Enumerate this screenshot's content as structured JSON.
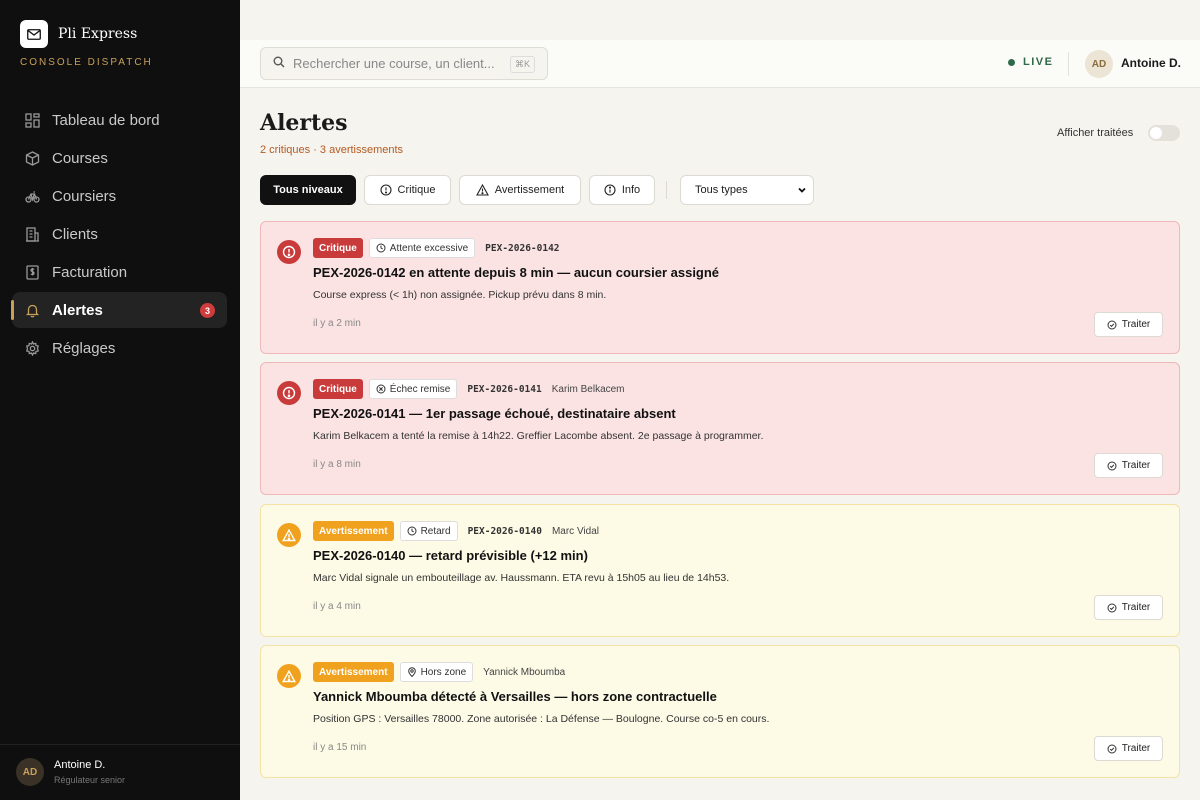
{
  "brand": {
    "name": "Pli Express",
    "subtitle": "CONSOLE DISPATCH"
  },
  "sidebar": {
    "items": [
      {
        "label": "Tableau de bord",
        "icon": "dashboard-icon"
      },
      {
        "label": "Courses",
        "icon": "package-icon"
      },
      {
        "label": "Coursiers",
        "icon": "bike-icon"
      },
      {
        "label": "Clients",
        "icon": "building-icon"
      },
      {
        "label": "Facturation",
        "icon": "invoice-icon"
      },
      {
        "label": "Alertes",
        "icon": "bell-icon",
        "active": true,
        "badge": "3"
      },
      {
        "label": "Réglages",
        "icon": "gear-icon"
      }
    ],
    "user": {
      "initials": "AD",
      "name": "Antoine D.",
      "role": "Régulateur senior"
    }
  },
  "topbar": {
    "search_placeholder": "Rechercher une course, un client...",
    "shortcut": "⌘K",
    "live_label": "LIVE",
    "user": {
      "initials": "AD",
      "name": "Antoine D."
    }
  },
  "page": {
    "title": "Alertes",
    "summary": "2 critiques · 3 avertissements",
    "toggle_label": "Afficher traitées",
    "toggle_on": false
  },
  "filters": {
    "levels": [
      {
        "label": "Tous niveaux",
        "active": true
      },
      {
        "label": "Critique",
        "icon": "alert-circle-icon"
      },
      {
        "label": "Avertissement",
        "icon": "warning-triangle-icon"
      },
      {
        "label": "Info",
        "icon": "info-icon"
      }
    ],
    "type_select": "Tous types"
  },
  "alerts": [
    {
      "level": "critical",
      "level_label": "Critique",
      "type": "Attente excessive",
      "type_icon": "clock-icon",
      "ref": "PEX-2026-0142",
      "courier": "",
      "title": "PEX-2026-0142 en attente depuis 8 min — aucun coursier assigné",
      "description": "Course express (< 1h) non assignée. Pickup prévu dans 8 min.",
      "time": "il y a 2 min",
      "action": "Traiter"
    },
    {
      "level": "critical",
      "level_label": "Critique",
      "type": "Échec remise",
      "type_icon": "x-circle-icon",
      "ref": "PEX-2026-0141",
      "courier": "Karim Belkacem",
      "title": "PEX-2026-0141 — 1er passage échoué, destinataire absent",
      "description": "Karim Belkacem a tenté la remise à 14h22. Greffier Lacombe absent. 2e passage à programmer.",
      "time": "il y a 8 min",
      "action": "Traiter"
    },
    {
      "level": "warning",
      "level_label": "Avertissement",
      "type": "Retard",
      "type_icon": "clock-icon",
      "ref": "PEX-2026-0140",
      "courier": "Marc Vidal",
      "title": "PEX-2026-0140 — retard prévisible (+12 min)",
      "description": "Marc Vidal signale un embouteillage av. Haussmann. ETA revu à 15h05 au lieu de 14h53.",
      "time": "il y a 4 min",
      "action": "Traiter"
    },
    {
      "level": "warning",
      "level_label": "Avertissement",
      "type": "Hors zone",
      "type_icon": "map-pin-icon",
      "ref": "",
      "courier": "Yannick Mboumba",
      "title": "Yannick Mboumba détecté à Versailles — hors zone contractuelle",
      "description": "Position GPS : Versailles 78000. Zone autorisée : La Défense — Boulogne. Course co-5 en cours.",
      "time": "il y a 15 min",
      "action": "Traiter"
    }
  ]
}
